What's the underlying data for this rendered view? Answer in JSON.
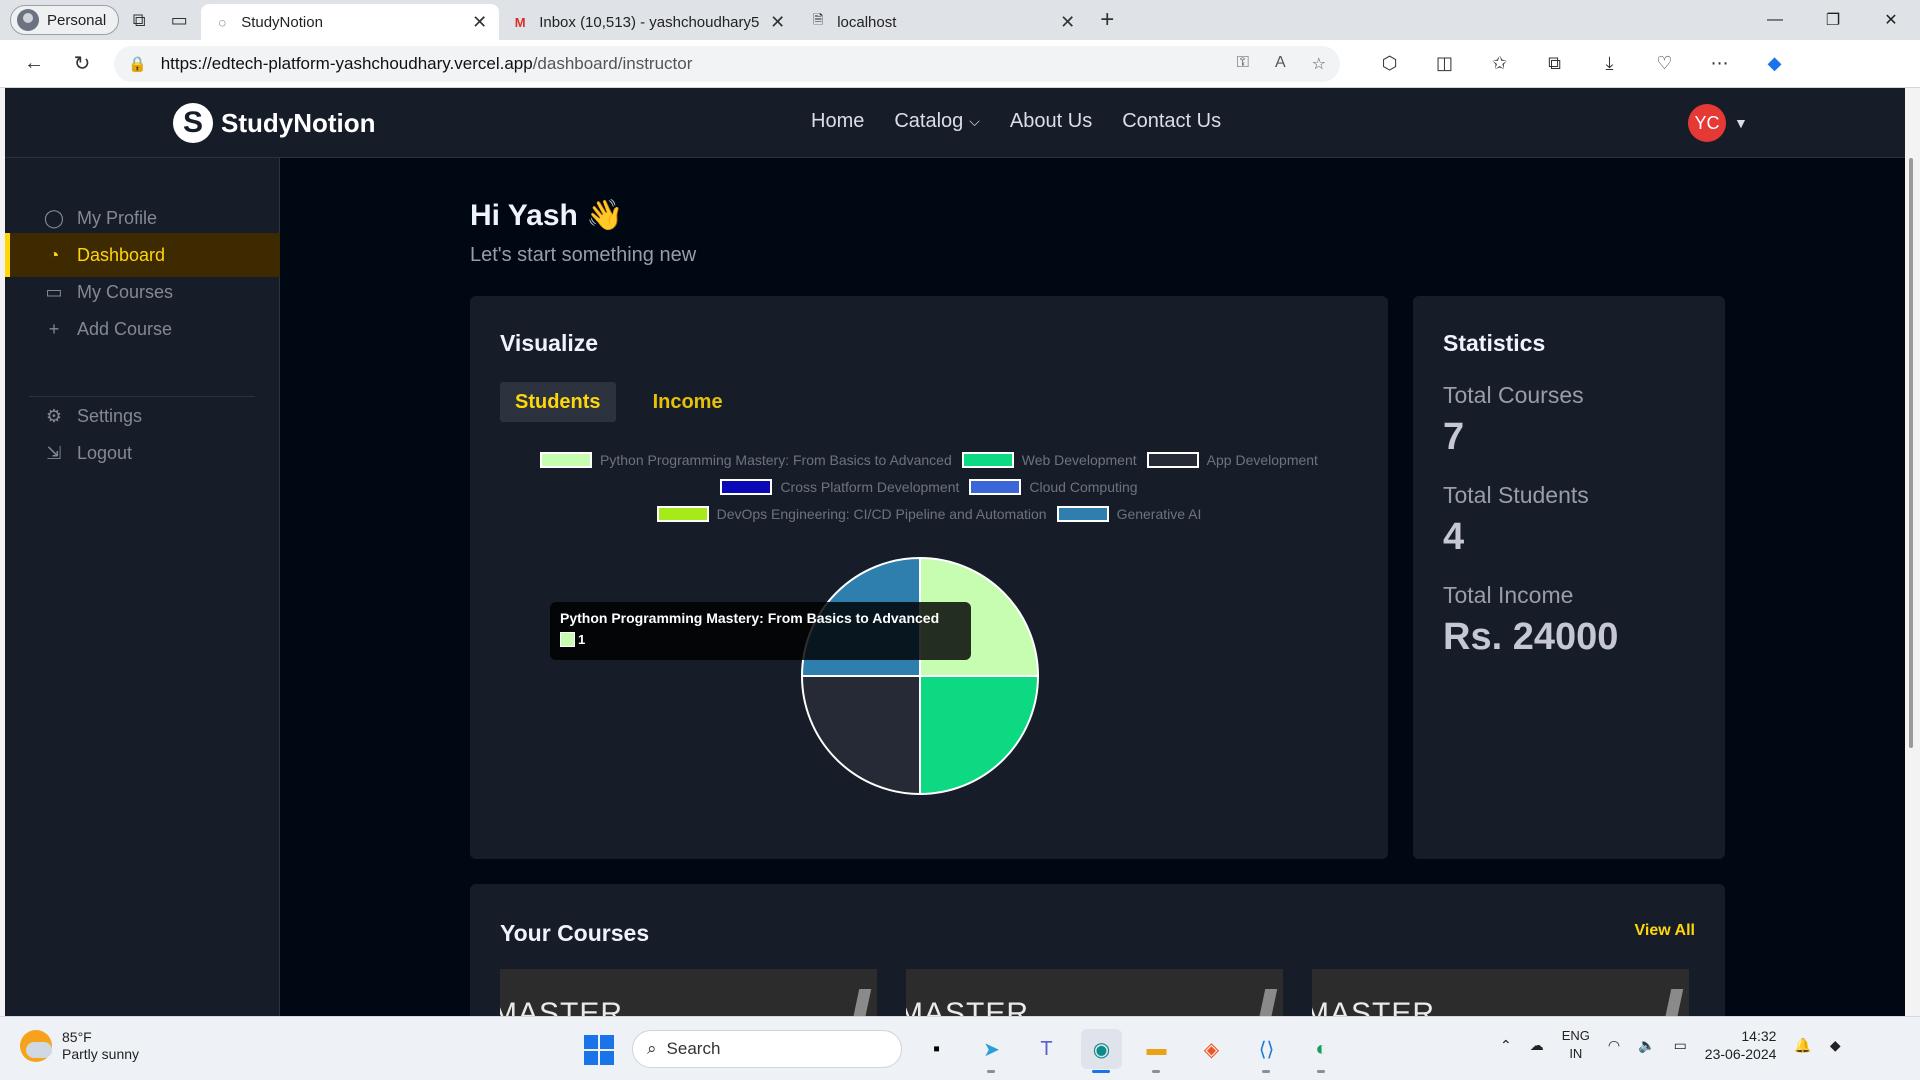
{
  "browser": {
    "profile": "Personal",
    "tabs": [
      {
        "title": "StudyNotion",
        "active": true
      },
      {
        "title": "Inbox (10,513) - yashchoudhary5",
        "active": false
      },
      {
        "title": "localhost",
        "active": false
      }
    ],
    "url_host": "https://edtech-platform-yashchoudhary.vercel.app",
    "url_path": "/dashboard/instructor"
  },
  "site": {
    "logo_text": "StudyNotion",
    "logo_letter": "S",
    "nav": [
      "Home",
      "Catalog",
      "About Us",
      "Contact Us"
    ],
    "avatar_initials": "YC"
  },
  "sidebar": {
    "items": [
      {
        "label": "My Profile",
        "icon": "user-circle-icon"
      },
      {
        "label": "Dashboard",
        "icon": "gauge-icon",
        "active": true
      },
      {
        "label": "My Courses",
        "icon": "monitor-icon"
      },
      {
        "label": "Add Course",
        "icon": "plus-icon"
      }
    ],
    "bottom_items": [
      {
        "label": "Settings",
        "icon": "gear-icon"
      },
      {
        "label": "Logout",
        "icon": "logout-icon"
      }
    ]
  },
  "dashboard": {
    "greeting": "Hi Yash 👋",
    "subtitle": "Let's start something new",
    "visualize_title": "Visualize",
    "tab_students": "Students",
    "tab_income": "Income",
    "tooltip": {
      "title": "Python Programming Mastery: From Basics to Advanced",
      "value": "1"
    },
    "stats_title": "Statistics",
    "stats": [
      {
        "label": "Total Courses",
        "value": "7"
      },
      {
        "label": "Total Students",
        "value": "4"
      },
      {
        "label": "Total Income",
        "value": "Rs. 24000"
      }
    ],
    "courses_title": "Your Courses",
    "view_all": "View All",
    "course_cards": [
      "MASTER",
      "MASTER",
      "MASTER"
    ]
  },
  "chart_data": {
    "type": "pie",
    "categories": [
      "Python Programming Mastery: From Basics to Advanced",
      "Web Development",
      "App Development",
      "Cross Platform Development",
      "Cloud Computing",
      "DevOps Engineering: CI/CD Pipeline and Automation",
      "Generative AI"
    ],
    "values": [
      1,
      1,
      1,
      0,
      0,
      0,
      1
    ],
    "colors": [
      "#c6fdb0",
      "#0cd981",
      "#262a36",
      "#0b08b8",
      "#3b66d8",
      "#a7ea1a",
      "#2e7fad"
    ],
    "legend_rows": [
      [
        0,
        1,
        2
      ],
      [
        3,
        4
      ],
      [
        5,
        6
      ]
    ]
  },
  "taskbar": {
    "weather_temp": "85°F",
    "weather_desc": "Partly sunny",
    "search": "Search",
    "lang_top": "ENG",
    "lang_bottom": "IN",
    "time": "14:32",
    "date": "23-06-2024"
  }
}
